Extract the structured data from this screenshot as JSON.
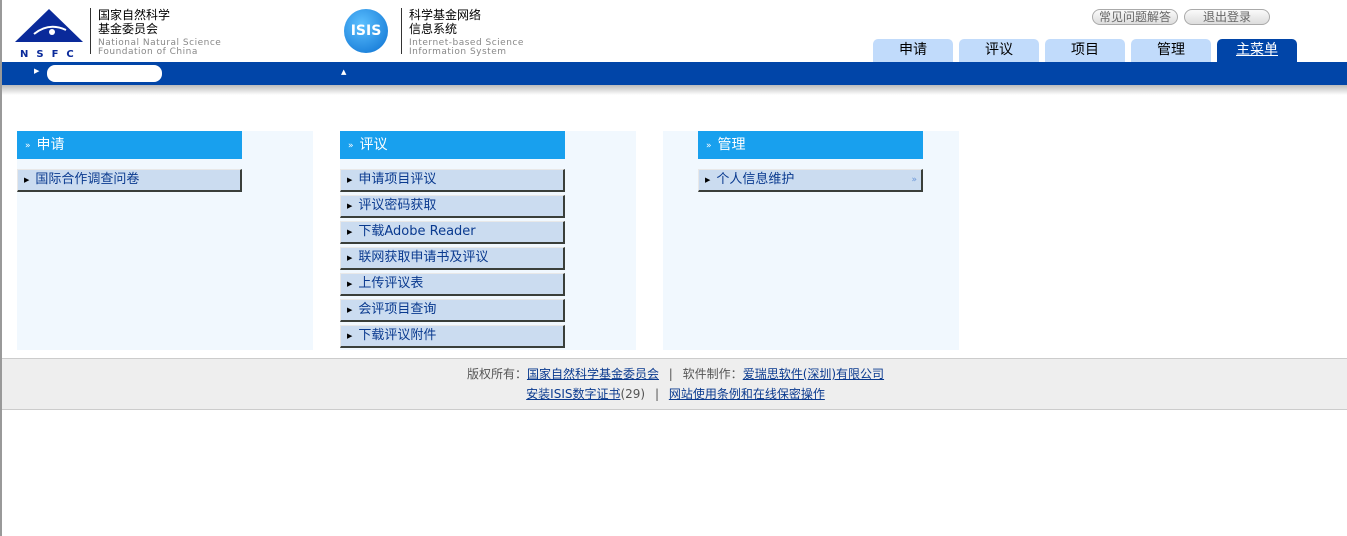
{
  "header": {
    "nsfc_logo_text": "NSFC",
    "nsfc_cn_line1": "国家自然科学",
    "nsfc_cn_line2": "基金委员会",
    "nsfc_en_line1": "National Natural Science",
    "nsfc_en_line2": "Foundation of China",
    "isis_logo_text": "ISIS",
    "isis_cn_line1": "科学基金网络",
    "isis_cn_line2": "信息系统",
    "isis_en_line1": "Internet-based Science",
    "isis_en_line2": "Information System",
    "faq_label": "常见问题解答",
    "logout_label": "退出登录"
  },
  "tabs": [
    {
      "label": "申请"
    },
    {
      "label": "评议"
    },
    {
      "label": "项目"
    },
    {
      "label": "管理"
    },
    {
      "label": "主菜单",
      "active": true
    }
  ],
  "panels": [
    {
      "title": "申请",
      "items": [
        "国际合作调查问卷"
      ]
    },
    {
      "title": "评议",
      "items": [
        "申请项目评议",
        "评议密码获取",
        "下载Adobe Reader",
        "联网获取申请书及评议",
        "上传评议表",
        "会评项目查询",
        "下载评议附件"
      ]
    },
    {
      "title": "管理",
      "items": [
        "个人信息维护"
      ]
    }
  ],
  "footer": {
    "copyright_label": "版权所有：",
    "copyright_link": "国家自然科学基金委员会",
    "sep": "|",
    "software_label": "软件制作：",
    "software_link": "爱瑞思软件(深圳)有限公司",
    "cert_link": "安装ISIS数字证书",
    "cert_count": "(29)",
    "terms_link": "网站使用条例和在线保密操作"
  },
  "colors": {
    "brand_blue": "#0145a8",
    "panel_header": "#18a0ee",
    "tab": "#c1dbfb"
  }
}
